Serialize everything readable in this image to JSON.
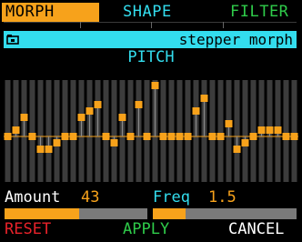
{
  "tabs": {
    "morph": "MORPH",
    "shape": "SHAPE",
    "filter": "FILTER"
  },
  "preset": {
    "name": "stepper morph",
    "icon": "folder-icon"
  },
  "section_label": "PITCH",
  "steps": [
    0,
    1,
    2,
    -1,
    -2,
    -3,
    2,
    0,
    0,
    1,
    1,
    3,
    4,
    -1,
    3,
    4,
    1,
    0,
    0,
    -2,
    2,
    1,
    6,
    0,
    0,
    2,
    5,
    3,
    0,
    0,
    3,
    1,
    7,
    4,
    0,
    0,
    2,
    0,
    1,
    0,
    0,
    0,
    0,
    2,
    3,
    -1,
    4,
    2,
    0,
    0,
    2,
    0,
    5,
    4,
    0,
    0,
    0,
    1,
    0,
    3,
    0,
    -3,
    5,
    5,
    0,
    0,
    0,
    0,
    0,
    2,
    0,
    -2,
    0,
    3,
    0,
    -1
  ],
  "step_series": [
    0,
    1,
    3,
    0,
    -2,
    -2,
    -1,
    0,
    0,
    3,
    4,
    5,
    0,
    -1,
    3,
    0,
    5,
    0,
    8,
    0,
    0,
    0,
    0,
    4,
    6,
    0,
    0,
    2,
    -2,
    -1,
    0,
    1,
    1,
    1,
    0,
    0
  ],
  "graph_range": [
    -3,
    9
  ],
  "params": {
    "amount_label": "Amount",
    "amount_value": "43",
    "freq_label": "Freq",
    "freq_value": "1.5",
    "amount_level": 0.52,
    "freq_level": 0.23
  },
  "actions": {
    "reset": "RESET",
    "apply": "APPLY",
    "cancel": "CANCEL"
  },
  "colors": {
    "accent": "#f7a21b",
    "cyan": "#33ddee",
    "green": "#2fcc4a",
    "red": "#e8222a",
    "white": "#ffffff",
    "grid_bar": "#3c3c3c",
    "stem": "#8a8a8a",
    "track": "#7a7a7a"
  }
}
